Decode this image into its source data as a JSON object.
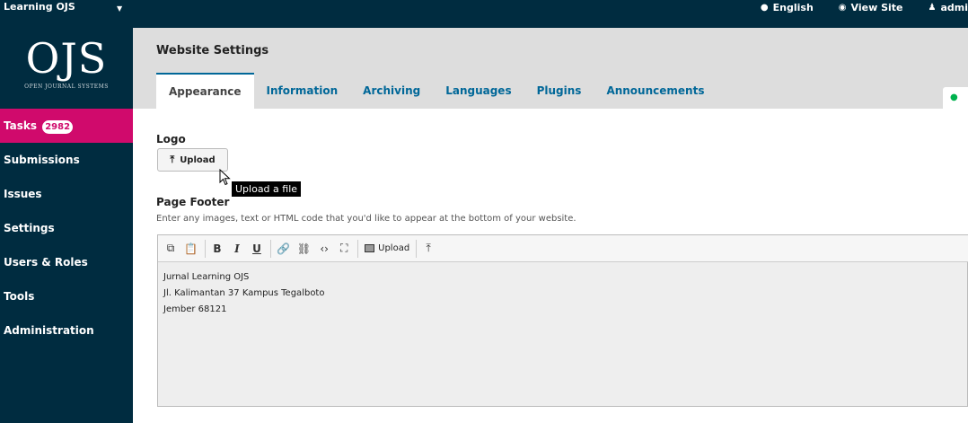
{
  "topbar": {
    "journal_name": "Learning OJS",
    "language_label": "English",
    "view_site_label": "View Site",
    "user_label": "admi"
  },
  "sidebar": {
    "logo_text": "OJS",
    "logo_subtitle": "OPEN JOURNAL SYSTEMS",
    "tasks_label": "Tasks",
    "tasks_count": "2982",
    "items": [
      {
        "label": "Submissions"
      },
      {
        "label": "Issues"
      },
      {
        "label": "Settings"
      },
      {
        "label": "Users & Roles"
      },
      {
        "label": "Tools"
      },
      {
        "label": "Administration"
      }
    ]
  },
  "header": {
    "title": "Website Settings",
    "tabs": [
      {
        "label": "Appearance",
        "active": true
      },
      {
        "label": "Information"
      },
      {
        "label": "Archiving"
      },
      {
        "label": "Languages"
      },
      {
        "label": "Plugins"
      },
      {
        "label": "Announcements"
      }
    ]
  },
  "main": {
    "logo_label": "Logo",
    "upload_label": "Upload",
    "tooltip": "Upload a file",
    "footer_label": "Page Footer",
    "footer_desc": "Enter any images, text or HTML code that you'd like to appear at the bottom of your website.",
    "editor_upload_label": "Upload",
    "footer_lines": [
      "Jurnal Learning OJS",
      "Jl. Kalimantan 37 Kampus Tegalboto",
      "Jember 68121"
    ]
  },
  "colors": {
    "nav_bg": "#002c40",
    "active_nav": "#d00a6c",
    "link": "#006798",
    "header_bg": "#dddddd"
  }
}
